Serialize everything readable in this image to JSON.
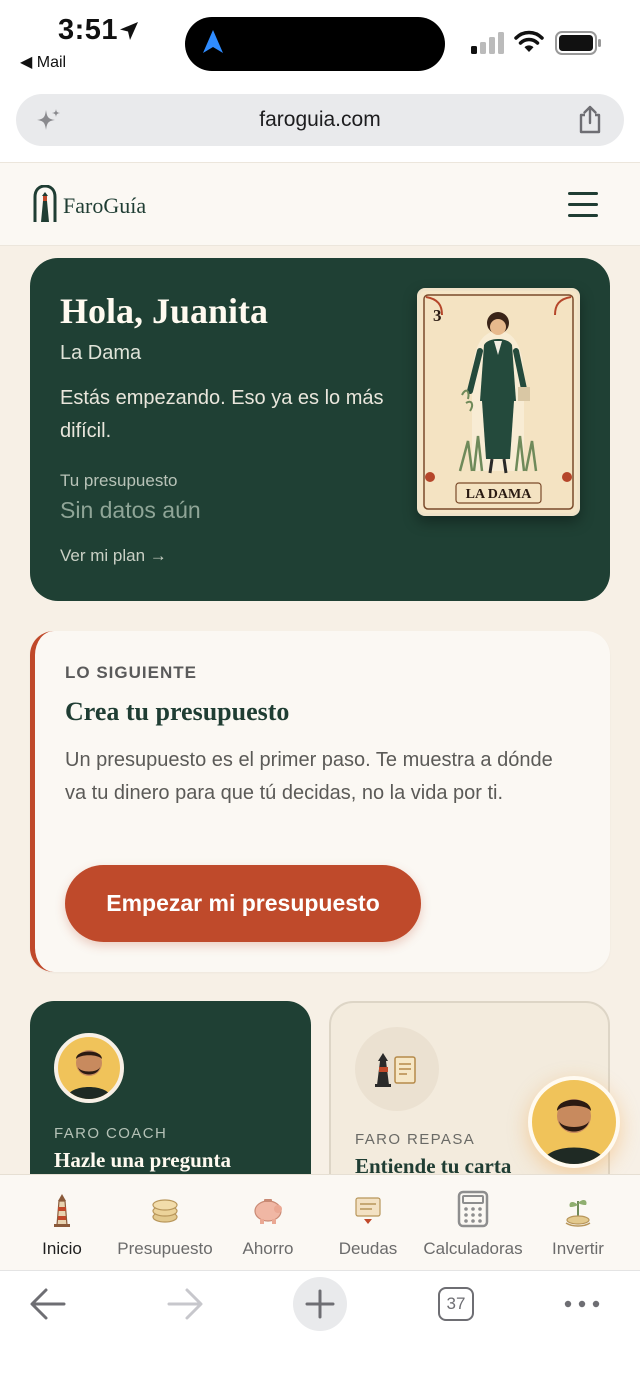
{
  "status_bar": {
    "time": "3:51",
    "back_app": "◀ Mail"
  },
  "browser": {
    "url": "faroguia.com",
    "tabs_count": "37"
  },
  "site": {
    "logo_text": "FaroGuía"
  },
  "hero": {
    "greeting": "Hola, Juanita",
    "card_name": "La Dama",
    "message": "Estás empezando. Eso ya es lo más difícil.",
    "budget_label": "Tu presupuesto",
    "budget_value": "Sin datos aún",
    "plan_link": "Ver mi plan →",
    "loteria_card": {
      "number": "3",
      "label": "LA DAMA"
    }
  },
  "next_step": {
    "kicker": "LO SIGUIENTE",
    "title": "Crea tu presupuesto",
    "body": "Un presupuesto es el primer paso. Te muestra a dónde va tu dinero para que tú decidas, no la vida por ti.",
    "cta": "Empezar mi presupuesto"
  },
  "coach_card": {
    "kicker": "FARO COACH",
    "title": "Hazle una pregunta"
  },
  "repasa_card": {
    "kicker": "FARO REPASA",
    "title": "Entiende tu carta"
  },
  "bottom_nav": [
    {
      "label": "Inicio",
      "icon": "lighthouse-icon",
      "active": true
    },
    {
      "label": "Presupuesto",
      "icon": "coins-icon"
    },
    {
      "label": "Ahorro",
      "icon": "piggy-bank-icon"
    },
    {
      "label": "Deudas",
      "icon": "bill-icon"
    },
    {
      "label": "Calculadoras",
      "icon": "calculator-icon"
    },
    {
      "label": "Invertir",
      "icon": "money-plant-icon"
    }
  ],
  "colors": {
    "primary_green": "#1f4034",
    "accent_rust": "#bf4a2b",
    "page_bg": "#f7f0e6",
    "fab_gold": "#f0c35a"
  }
}
